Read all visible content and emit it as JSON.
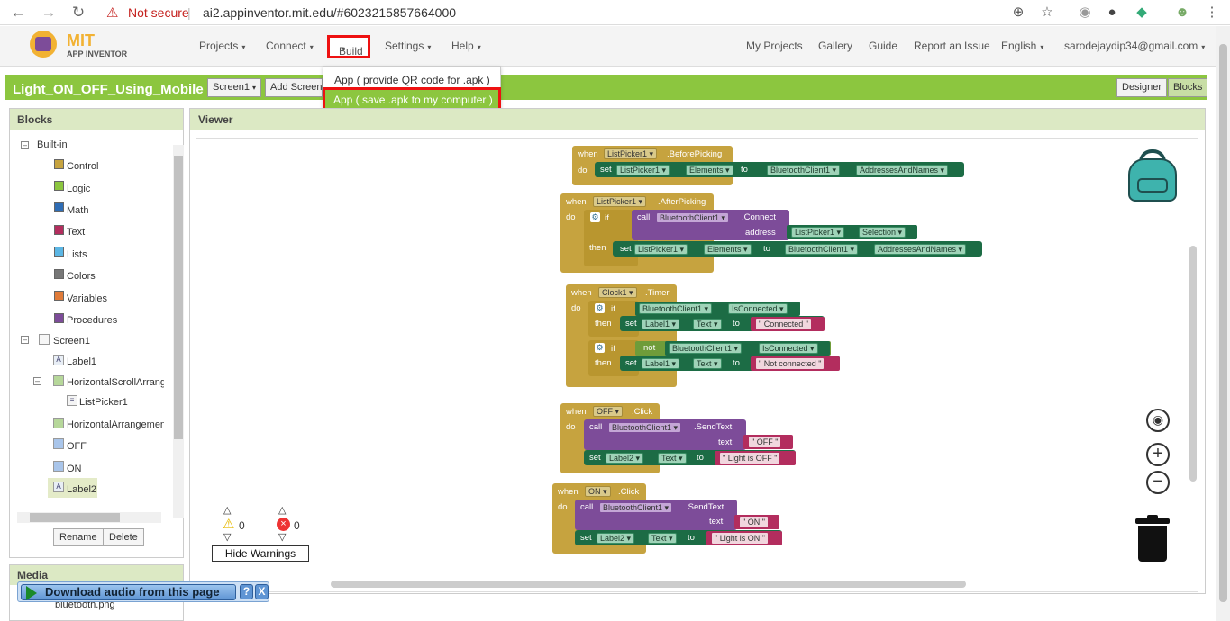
{
  "browser": {
    "security_label": "Not secure",
    "url": "ai2.appinventor.mit.edu/#6023215857664000"
  },
  "app": {
    "logo_top": "MIT",
    "logo_bottom": "APP INVENTOR",
    "menus": [
      "Projects",
      "Connect",
      "Build",
      "Settings",
      "Help"
    ],
    "right_links": [
      "My Projects",
      "Gallery",
      "Guide",
      "Report an Issue",
      "English",
      "sarodejaydip34@gmail.com"
    ],
    "build_dropdown": [
      "App ( provide QR code for .apk )",
      "App ( save .apk to my computer )"
    ],
    "accent": "#8cc63f",
    "highlight_color": "#e11111"
  },
  "project": {
    "name": "Light_ON_OFF_Using_Mobile",
    "screen_select": "Screen1",
    "add_screen": "Add Screen",
    "designer": "Designer",
    "blocks": "Blocks"
  },
  "blocks_panel": {
    "title": "Blocks",
    "builtin": "Built-in",
    "builtin_items": [
      {
        "label": "Control",
        "color": "#c6a33f"
      },
      {
        "label": "Logic",
        "color": "#8cc63f"
      },
      {
        "label": "Math",
        "color": "#2f6db5"
      },
      {
        "label": "Text",
        "color": "#b32d5e"
      },
      {
        "label": "Lists",
        "color": "#5bb6e4"
      },
      {
        "label": "Colors",
        "color": "#777777"
      },
      {
        "label": "Variables",
        "color": "#e07b39"
      },
      {
        "label": "Procedures",
        "color": "#7d4c99"
      }
    ],
    "screen": "Screen1",
    "components": [
      "Label1",
      "HorizontalScrollArrang",
      "ListPicker1",
      "HorizontalArrangemen",
      "OFF",
      "ON",
      "Label2"
    ],
    "rename": "Rename",
    "delete": "Delete",
    "media_title": "Media",
    "media_file": "bluetooth.png"
  },
  "viewer": {
    "title": "Viewer",
    "warnings_count": "0",
    "errors_count": "0",
    "hide_warnings": "Hide Warnings"
  },
  "block_text": {
    "when": "when",
    "do": "do",
    "set": "set",
    "to": "to",
    "call": "call",
    "if": "if",
    "then": "then",
    "not": "not",
    "address": "address",
    "text": "text",
    "b1_comp": "ListPicker1",
    "b1_event": ".BeforePicking",
    "b1_prop": "Elements",
    "b1_bt": "BluetoothClient1",
    "b1_val": "AddressesAndNames",
    "b2_comp": "ListPicker1",
    "b2_event": ".AfterPicking",
    "b2_bt": "BluetoothClient1",
    "b2_method": ".Connect",
    "b2_sel": "Selection",
    "b3_comp": "Clock1",
    "b3_event": ".Timer",
    "b3_conn": "IsConnected",
    "label1": "Label1",
    "text_prop": "Text",
    "str_connected": "Connected",
    "str_not_connected": "Not connected",
    "b4_comp": "OFF",
    "b4_event": ".Click",
    "send_text": ".SendText",
    "str_off": "OFF",
    "label2": "Label2",
    "str_light_off": "Light is OFF",
    "b5_comp": "ON",
    "b5_event": ".Click",
    "str_on": "ON",
    "str_light_on": "Light is ON"
  },
  "download_bar": {
    "label": "Download audio from this page",
    "help": "?",
    "close": "X"
  }
}
